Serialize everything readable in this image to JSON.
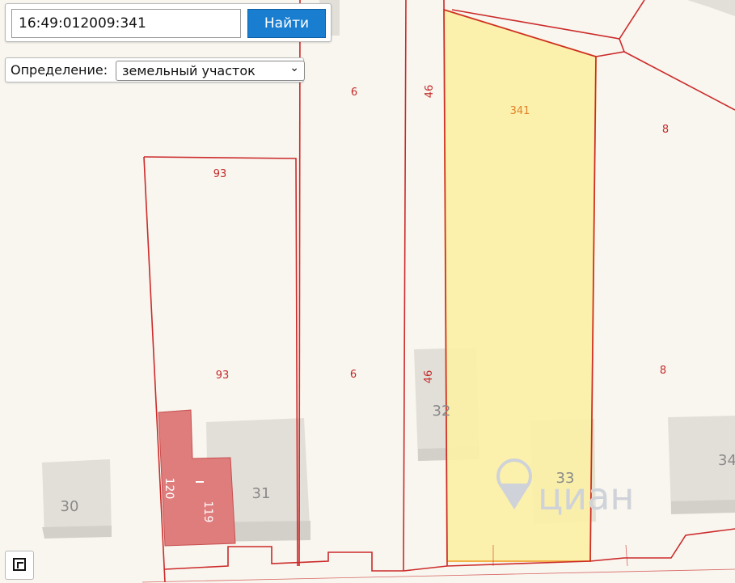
{
  "search": {
    "value": "16:49:012009:341",
    "button_label": "Найти"
  },
  "definition": {
    "label": "Определение:",
    "selected": "земельный участок"
  },
  "parcels": {
    "selected": "341",
    "p6_top": "6",
    "p6_mid": "6",
    "p46_top": "46",
    "p46_mid": "46",
    "p93_top": "93",
    "p93_mid": "93",
    "p8_top": "8",
    "p8_mid": "8",
    "p120": "120",
    "p119": "119",
    "p_i": "I"
  },
  "buildings": {
    "b30": "30",
    "b31": "31",
    "b32": "32",
    "b33": "33",
    "b34": "34"
  },
  "watermark": {
    "brand": "циан"
  },
  "colors": {
    "boundary": "#cc2a2a",
    "selected_fill": "#fbf0a6",
    "selected_stroke": "#f2b24a",
    "building_fill": "#e2dfd9",
    "structure_fill": "#df7c7c"
  },
  "icons": {
    "measure": "measure-icon"
  }
}
